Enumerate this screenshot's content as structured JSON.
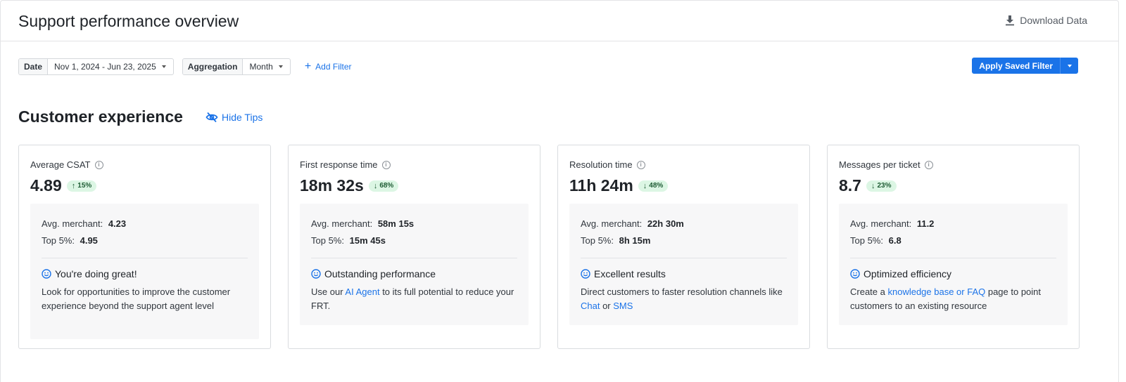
{
  "header": {
    "title": "Support performance overview",
    "download_label": "Download Data"
  },
  "filters": {
    "date_label": "Date",
    "date_value": "Nov 1, 2024 - Jun 23, 2025",
    "aggregation_label": "Aggregation",
    "aggregation_value": "Month",
    "add_filter_label": "Add Filter",
    "apply_saved_label": "Apply Saved Filter"
  },
  "section": {
    "title": "Customer experience",
    "hide_tips_label": "Hide Tips"
  },
  "colors": {
    "accent": "#1a73e8",
    "delta_bg": "#dcf6e4",
    "delta_text": "#1e5c34"
  },
  "cards": [
    {
      "title": "Average CSAT",
      "value": "4.89",
      "delta_dir": "up",
      "delta": "15%",
      "avg_label": "Avg. merchant:",
      "avg_value": "4.23",
      "top_label": "Top 5%:",
      "top_value": "4.95",
      "tip_title": "You're doing great!",
      "tip_body": [
        {
          "text": "Look for opportunities to improve the customer experience beyond the support agent level",
          "link": false
        }
      ]
    },
    {
      "title": "First response time",
      "value": "18m 32s",
      "delta_dir": "down",
      "delta": "68%",
      "avg_label": "Avg. merchant:",
      "avg_value": "58m 15s",
      "top_label": "Top 5%:",
      "top_value": "15m 45s",
      "tip_title": "Outstanding performance",
      "tip_body": [
        {
          "text": "Use our ",
          "link": false
        },
        {
          "text": "AI Agent",
          "link": true
        },
        {
          "text": " to its full potential to reduce your FRT.",
          "link": false
        }
      ]
    },
    {
      "title": "Resolution time",
      "value": "11h 24m",
      "delta_dir": "down",
      "delta": "48%",
      "avg_label": "Avg. merchant:",
      "avg_value": "22h 30m",
      "top_label": "Top 5%:",
      "top_value": "8h 15m",
      "tip_title": "Excellent results",
      "tip_body": [
        {
          "text": "Direct customers to faster resolution channels like ",
          "link": false
        },
        {
          "text": "Chat",
          "link": true
        },
        {
          "text": " or ",
          "link": false
        },
        {
          "text": "SMS",
          "link": true
        }
      ]
    },
    {
      "title": "Messages per ticket",
      "value": "8.7",
      "delta_dir": "down",
      "delta": "23%",
      "avg_label": "Avg. merchant:",
      "avg_value": "11.2",
      "top_label": "Top 5%:",
      "top_value": "6.8",
      "tip_title": "Optimized efficiency",
      "tip_body": [
        {
          "text": "Create a ",
          "link": false
        },
        {
          "text": "knowledge base or FAQ",
          "link": true
        },
        {
          "text": " page to point customers to an existing resource",
          "link": false
        }
      ]
    }
  ]
}
